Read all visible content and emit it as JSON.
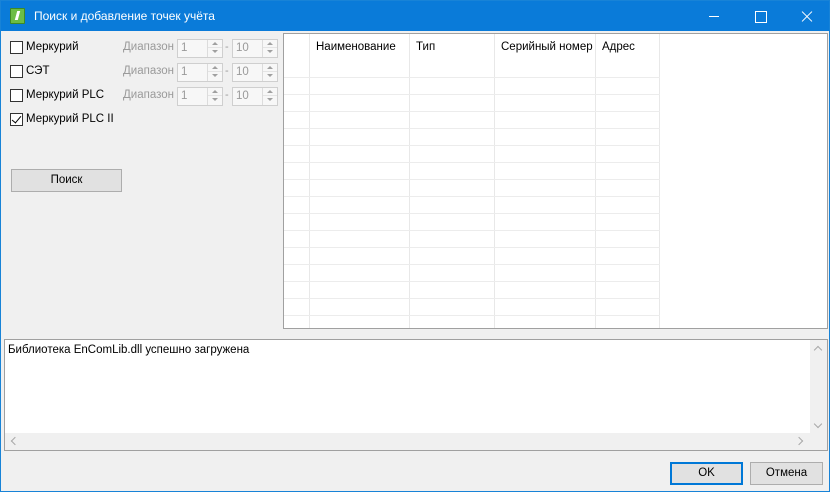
{
  "window": {
    "title": "Поиск и добавление точек учёта"
  },
  "devices": [
    {
      "label": "Меркурий",
      "checked": false,
      "range_label": "Диапазон",
      "from": "1",
      "to": "10",
      "separator": "-"
    },
    {
      "label": "СЭТ",
      "checked": false,
      "range_label": "Диапазон",
      "from": "1",
      "to": "10",
      "separator": "-"
    },
    {
      "label": "Меркурий PLC",
      "checked": false,
      "range_label": "Диапазон",
      "from": "1",
      "to": "10",
      "separator": "-"
    },
    {
      "label": "Меркурий PLC II",
      "checked": true
    }
  ],
  "search_button": "Поиск",
  "grid": {
    "columns": [
      "",
      "Наименование",
      "Тип",
      "Серийный номер",
      "Адрес"
    ]
  },
  "log": {
    "text": "Библиотека EnComLib.dll успешно загружена"
  },
  "buttons": {
    "ok": "OK",
    "cancel": "Отмена"
  },
  "colors": {
    "titlebar": "#0a7bd9",
    "accent": "#0078d7",
    "app_icon": "#6cbd45"
  }
}
